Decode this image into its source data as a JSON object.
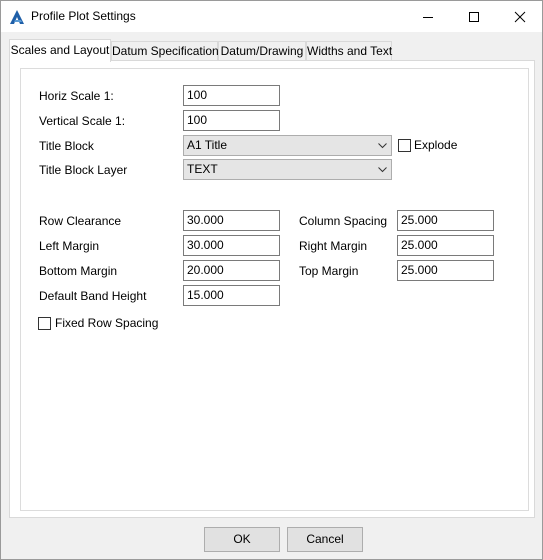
{
  "window": {
    "title": "Profile Plot Settings",
    "icon": "autodesk-app-icon",
    "controls": [
      "minimize-icon",
      "maximize-icon",
      "close-icon"
    ]
  },
  "tabs": [
    {
      "label": "Scales and Layout",
      "active": true
    },
    {
      "label": "Datum Specification",
      "active": false
    },
    {
      "label": "Datum/Drawing",
      "active": false
    },
    {
      "label": "Widths and Text",
      "active": false
    }
  ],
  "form": {
    "horiz_scale": {
      "label": "Horiz Scale 1:",
      "value": "100"
    },
    "vertical_scale": {
      "label": "Vertical Scale 1:",
      "value": "100"
    },
    "title_block": {
      "label": "Title Block",
      "value": "A1 Title"
    },
    "explode": {
      "label": "Explode",
      "checked": false
    },
    "title_block_layer": {
      "label": "Title Block Layer",
      "value": "TEXT"
    },
    "row_clearance": {
      "label": "Row Clearance",
      "value": "30.000"
    },
    "column_spacing": {
      "label": "Column Spacing",
      "value": "25.000"
    },
    "left_margin": {
      "label": "Left Margin",
      "value": "30.000"
    },
    "right_margin": {
      "label": "Right Margin",
      "value": "25.000"
    },
    "bottom_margin": {
      "label": "Bottom Margin",
      "value": "20.000"
    },
    "top_margin": {
      "label": "Top Margin",
      "value": "25.000"
    },
    "default_band_height": {
      "label": "Default Band Height",
      "value": "15.000"
    },
    "fixed_row_spacing": {
      "label": "Fixed Row Spacing",
      "checked": false
    }
  },
  "buttons": {
    "ok": "OK",
    "cancel": "Cancel"
  },
  "colors": {
    "titlebar": "#ffffff",
    "dialog": "#f0f0f0",
    "panel": "#ffffff",
    "app_icon": "#1f5fa8"
  }
}
